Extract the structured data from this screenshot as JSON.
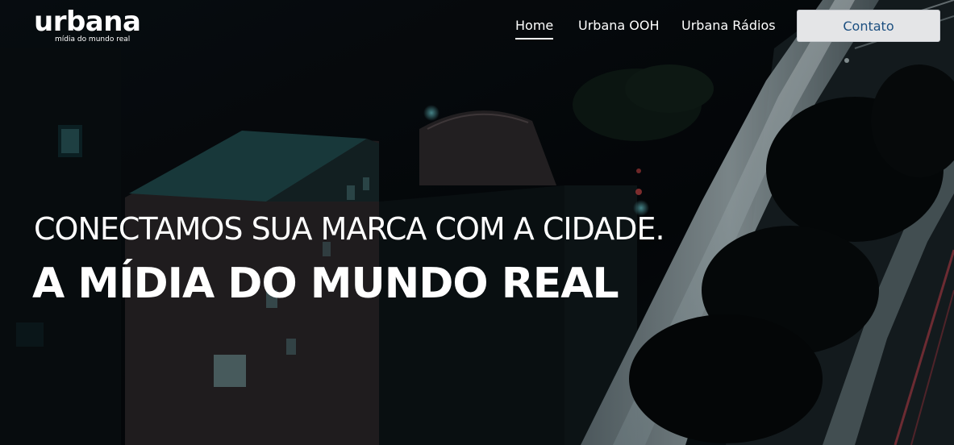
{
  "brand": {
    "name": "urbana",
    "tagline": "mídia do mundo real"
  },
  "nav": {
    "items": [
      {
        "label": "Home",
        "active": true
      },
      {
        "label": "Urbana OOH",
        "active": false
      },
      {
        "label": "Urbana Rádios",
        "active": false
      }
    ],
    "contact_label": "Contato"
  },
  "hero": {
    "headline": "CONECTAMOS SUA MARCA COM A CIDADE.",
    "subheadline": "A MÍDIA DO MUNDO REAL",
    "background_icon": "night-city-photo"
  },
  "colors": {
    "text": "#ffffff",
    "button_bg": "#e4e5e7",
    "button_text": "#1c4f80",
    "background": "#070b0e"
  }
}
